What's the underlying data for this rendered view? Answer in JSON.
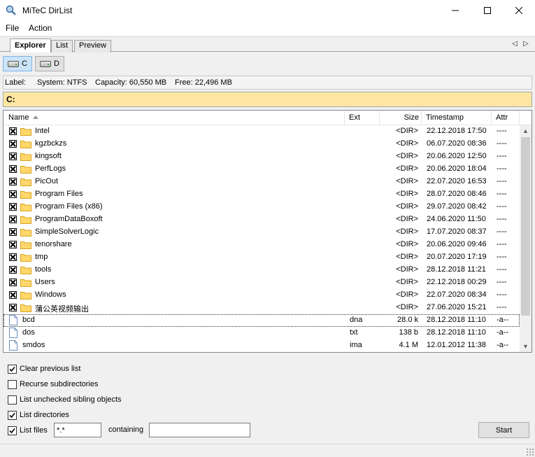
{
  "window": {
    "title": "MiTeC DirList"
  },
  "menu": [
    "File",
    "Action"
  ],
  "tabs": [
    {
      "label": "Explorer",
      "active": true
    },
    {
      "label": "List",
      "active": false
    },
    {
      "label": "Preview",
      "active": false
    }
  ],
  "drives": [
    {
      "label": "C",
      "active": true
    },
    {
      "label": "D",
      "active": false
    }
  ],
  "info": {
    "label": "Label:",
    "system": "System: NTFS",
    "capacity": "Capacity: 60,550 MB",
    "free": "Free: 22,496 MB"
  },
  "path": "C:",
  "columns": {
    "name": "Name",
    "ext": "Ext",
    "size": "Size",
    "timestamp": "Timestamp",
    "attr": "Attr"
  },
  "rows": [
    {
      "type": "folder",
      "name": "Intel",
      "ext": "",
      "size": "<DIR>",
      "timestamp": "22.12.2018 17:50",
      "attr": "----"
    },
    {
      "type": "folder",
      "name": "kgzbckzs",
      "ext": "",
      "size": "<DIR>",
      "timestamp": "06.07.2020 08:36",
      "attr": "----"
    },
    {
      "type": "folder",
      "name": "kingsoft",
      "ext": "",
      "size": "<DIR>",
      "timestamp": "20.06.2020 12:50",
      "attr": "----"
    },
    {
      "type": "folder",
      "name": "PerfLogs",
      "ext": "",
      "size": "<DIR>",
      "timestamp": "20.06.2020 18:04",
      "attr": "----"
    },
    {
      "type": "folder",
      "name": "PicOut",
      "ext": "",
      "size": "<DIR>",
      "timestamp": "22.07.2020 16:53",
      "attr": "----"
    },
    {
      "type": "folder",
      "name": "Program Files",
      "ext": "",
      "size": "<DIR>",
      "timestamp": "28.07.2020 08:46",
      "attr": "----"
    },
    {
      "type": "folder",
      "name": "Program Files (x86)",
      "ext": "",
      "size": "<DIR>",
      "timestamp": "29.07.2020 08:42",
      "attr": "----"
    },
    {
      "type": "folder",
      "name": "ProgramDataBoxoft",
      "ext": "",
      "size": "<DIR>",
      "timestamp": "24.06.2020 11:50",
      "attr": "----"
    },
    {
      "type": "folder",
      "name": "SimpleSolverLogic",
      "ext": "",
      "size": "<DIR>",
      "timestamp": "17.07.2020 08:37",
      "attr": "----"
    },
    {
      "type": "folder",
      "name": "tenorshare",
      "ext": "",
      "size": "<DIR>",
      "timestamp": "20.06.2020 09:46",
      "attr": "----"
    },
    {
      "type": "folder",
      "name": "tmp",
      "ext": "",
      "size": "<DIR>",
      "timestamp": "20.07.2020 17:19",
      "attr": "----"
    },
    {
      "type": "folder",
      "name": "tools",
      "ext": "",
      "size": "<DIR>",
      "timestamp": "28.12.2018 11:21",
      "attr": "----"
    },
    {
      "type": "folder",
      "name": "Users",
      "ext": "",
      "size": "<DIR>",
      "timestamp": "22.12.2018 00:29",
      "attr": "----"
    },
    {
      "type": "folder",
      "name": "Windows",
      "ext": "",
      "size": "<DIR>",
      "timestamp": "22.07.2020 08:34",
      "attr": "----"
    },
    {
      "type": "folder",
      "name": "蒲公英视频输出",
      "ext": "",
      "size": "<DIR>",
      "timestamp": "27.06.2020 15:21",
      "attr": "----"
    },
    {
      "type": "file",
      "name": "bcd",
      "ext": "dna",
      "size": "28.0 k",
      "timestamp": "28.12.2018 11:10",
      "attr": "-a--",
      "selected": true
    },
    {
      "type": "file",
      "name": "dos",
      "ext": "txt",
      "size": "138 b",
      "timestamp": "28.12.2018 11:10",
      "attr": "-a--"
    },
    {
      "type": "file",
      "name": "smdos",
      "ext": "ima",
      "size": "4.1 M",
      "timestamp": "12.01.2012 11:38",
      "attr": "-a--"
    }
  ],
  "options": {
    "clear_previous": {
      "label": "Clear previous list",
      "checked": true
    },
    "recurse": {
      "label": "Recurse subdirectories",
      "checked": false
    },
    "list_unchecked": {
      "label": "List unchecked sibling objects",
      "checked": false
    },
    "list_dirs": {
      "label": "List directories",
      "checked": true
    },
    "list_files": {
      "label": "List files",
      "checked": true
    },
    "mask": "*.*",
    "containing_label": "containing",
    "containing_value": ""
  },
  "start_label": "Start"
}
